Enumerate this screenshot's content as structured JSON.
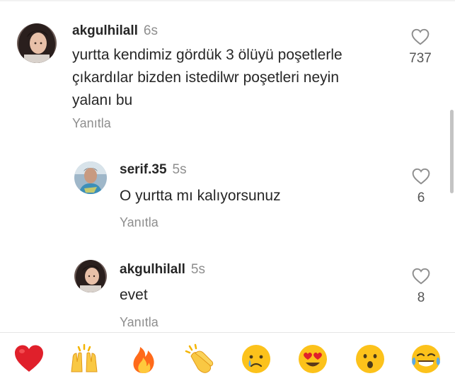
{
  "comments": [
    {
      "username": "akgulhilall",
      "time": "6s",
      "text": "yurtta kendimiz gördük 3 ölüyü poşetlerle\nçıkardılar bizden istedilwr poşetleri neyin\nyalanı bu",
      "reply_label": "Yanıtla",
      "likes": "737"
    },
    {
      "username": "serif.35",
      "time": "5s",
      "text": "O yurtta mı kalıyorsunuz",
      "reply_label": "Yanıtla",
      "likes": "6"
    },
    {
      "username": "akgulhilall",
      "time": "5s",
      "text": "evet",
      "reply_label": "Yanıtla",
      "likes": "8"
    }
  ],
  "emoji_bar": [
    {
      "name": "red-heart",
      "emoji": "❤️"
    },
    {
      "name": "raising-hands",
      "emoji": "🙌"
    },
    {
      "name": "fire",
      "emoji": "🔥"
    },
    {
      "name": "clapping-hands",
      "emoji": "👏"
    },
    {
      "name": "crying-face",
      "emoji": "😢"
    },
    {
      "name": "heart-eyes",
      "emoji": "😍"
    },
    {
      "name": "surprised-face",
      "emoji": "😮"
    },
    {
      "name": "tears-of-joy",
      "emoji": "😂"
    }
  ],
  "colors": {
    "text": "#262626",
    "secondary": "#8e8e8e",
    "heart_outline": "#8e8e8e",
    "like_red": "#ed4956"
  }
}
